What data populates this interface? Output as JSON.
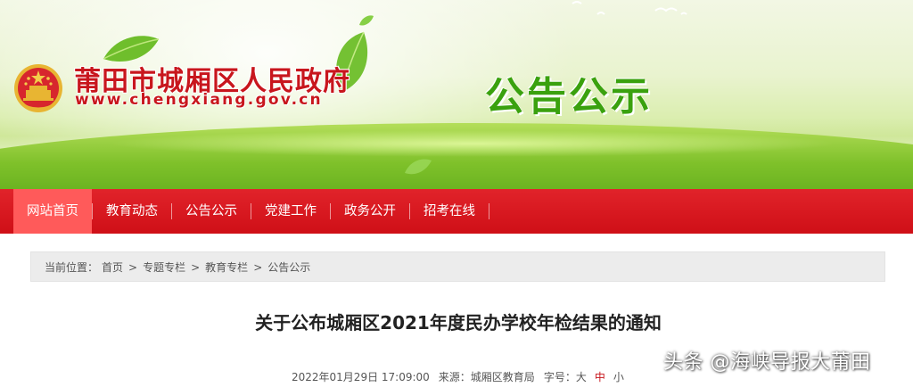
{
  "header": {
    "site_name": "莆田市城厢区人民政府",
    "site_url": "www.chengxiang.gov.cn",
    "section_title": "公告公示",
    "emblem_icon": "national-emblem-icon"
  },
  "nav": {
    "items": [
      {
        "label": "网站首页",
        "active": true
      },
      {
        "label": "教育动态",
        "active": false
      },
      {
        "label": "公告公示",
        "active": false
      },
      {
        "label": "党建工作",
        "active": false
      },
      {
        "label": "政务公开",
        "active": false
      },
      {
        "label": "招考在线",
        "active": false
      }
    ],
    "bg_color": "#d8141c",
    "active_color": "#ff5a5a"
  },
  "breadcrumb": {
    "prefix": "当前位置：",
    "items": [
      "首页",
      "专题专栏",
      "教育专栏",
      "公告公示"
    ],
    "separator": ">"
  },
  "article": {
    "title": "关于公布城厢区2021年度民办学校年检结果的通知",
    "datetime": "2022年01月29日 17:09:00",
    "source": "来源：城厢区教育局",
    "font_size_label": "字号：",
    "font_size_options": [
      "大",
      "中",
      "小"
    ]
  },
  "watermark": {
    "text": "头条 @海峡导报大莆田"
  },
  "colors": {
    "brand_red": "#c8161d",
    "title_green": "#3aa10e"
  }
}
